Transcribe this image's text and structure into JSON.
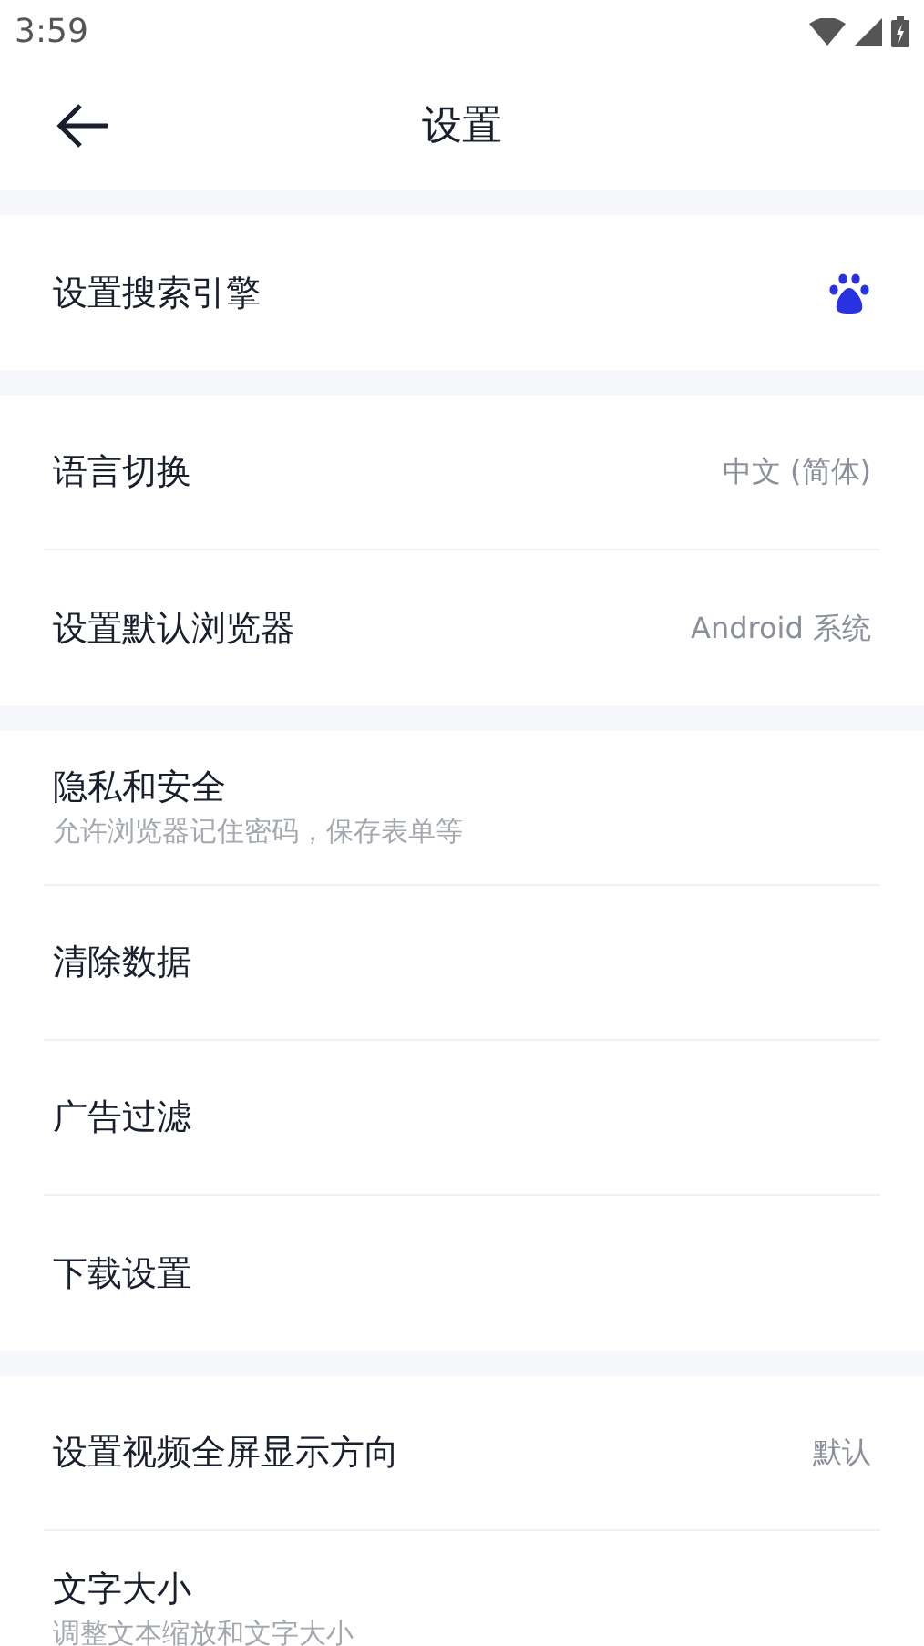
{
  "status_bar": {
    "time": "3:59"
  },
  "header": {
    "title": "设置"
  },
  "sections": [
    {
      "items": [
        {
          "kind": "icon",
          "title": "设置搜索引擎"
        }
      ]
    },
    {
      "items": [
        {
          "kind": "value",
          "title": "语言切换",
          "value": "中文 (简体)"
        },
        {
          "kind": "value",
          "title": "设置默认浏览器",
          "value": "Android 系统"
        }
      ]
    },
    {
      "items": [
        {
          "kind": "subtitle",
          "title": "隐私和安全",
          "subtitle": "允许浏览器记住密码，保存表单等"
        },
        {
          "kind": "plain",
          "title": "清除数据"
        },
        {
          "kind": "plain",
          "title": "广告过滤"
        },
        {
          "kind": "plain",
          "title": "下载设置"
        }
      ]
    },
    {
      "items": [
        {
          "kind": "value",
          "title": "设置视频全屏显示方向",
          "value": "默认"
        },
        {
          "kind": "subtitle",
          "title": "文字大小",
          "subtitle": "调整文本缩放和文字大小"
        }
      ]
    }
  ]
}
